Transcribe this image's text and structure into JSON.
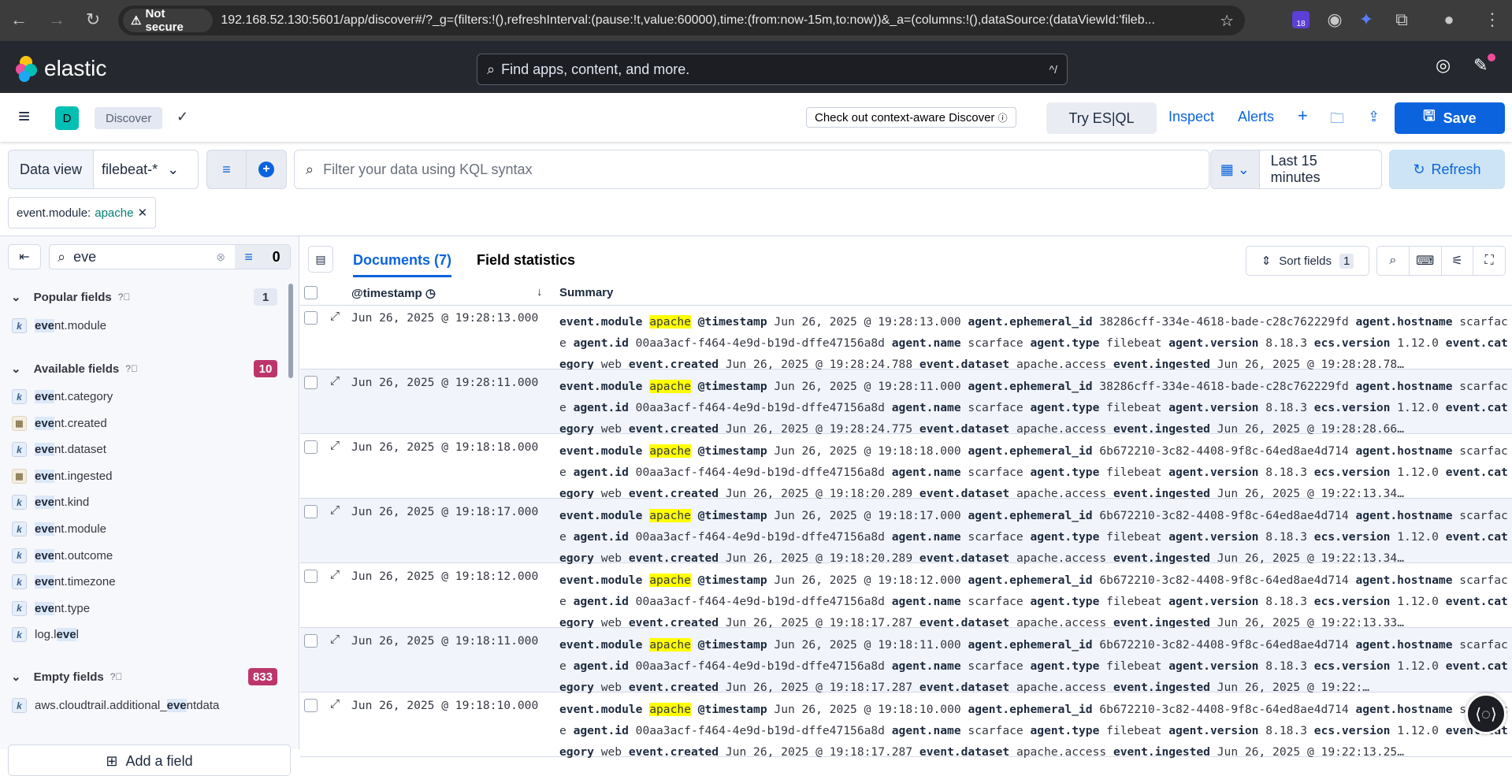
{
  "browser": {
    "not_secure": "Not secure",
    "url": "192.168.52.130:5601/app/discover#/?_g=(filters:!(),refreshInterval:(pause:!t,value:60000),time:(from:now-15m,to:now))&_a=(columns:!(),dataSource:(dataViewId:'fileb...",
    "ext_badge": "18"
  },
  "header": {
    "logo": "elastic",
    "search_placeholder": "Find apps, content, and more.",
    "shortcut": "^/"
  },
  "appbar": {
    "space": "D",
    "breadcrumb": "Discover",
    "context_button": "Check out context-aware Discover",
    "esql": "Try ES|QL",
    "inspect": "Inspect",
    "alerts": "Alerts",
    "save": "Save"
  },
  "query": {
    "data_view_label": "Data view",
    "data_view": "filebeat-*",
    "placeholder": "Filter your data using KQL syntax",
    "time": "Last 15 minutes",
    "refresh": "Refresh"
  },
  "filter_pill": {
    "key": "event.module:",
    "value": "apache"
  },
  "sidebar": {
    "search_value": "eve",
    "filter_count": "0",
    "add_field": "Add a field",
    "popular": {
      "title": "Popular fields",
      "count": "1"
    },
    "available": {
      "title": "Available fields",
      "count": "10",
      "color": "#bd366b"
    },
    "empty": {
      "title": "Empty fields",
      "count": "833",
      "color": "#bd366b"
    },
    "popular_fields": [
      {
        "name": "event.module",
        "type": "keyword"
      }
    ],
    "available_fields": [
      {
        "name": "event.category",
        "type": "keyword"
      },
      {
        "name": "event.created",
        "type": "date"
      },
      {
        "name": "event.dataset",
        "type": "keyword"
      },
      {
        "name": "event.ingested",
        "type": "date"
      },
      {
        "name": "event.kind",
        "type": "keyword"
      },
      {
        "name": "event.module",
        "type": "keyword"
      },
      {
        "name": "event.outcome",
        "type": "keyword"
      },
      {
        "name": "event.timezone",
        "type": "keyword"
      },
      {
        "name": "event.type",
        "type": "keyword"
      },
      {
        "name": "log.level",
        "type": "keyword"
      }
    ],
    "empty_fields": [
      {
        "name": "aws.cloudtrail.additional_eventdata",
        "type": "keyword"
      }
    ]
  },
  "main": {
    "tab_documents": "Documents (7)",
    "tab_stats": "Field statistics",
    "sort_fields": "Sort fields",
    "sort_count": "1",
    "col_timestamp": "@timestamp",
    "col_summary": "Summary"
  },
  "rows": [
    {
      "ts": "Jun 26, 2025 @ 19:28:13.000",
      "eph": "38286cff-334e-4618-bade-c28c762229fd",
      "created": "Jun 26, 2025 @ 19:28:24.788",
      "ingested": "Jun 26, 2025 @ 19:28:28.78"
    },
    {
      "ts": "Jun 26, 2025 @ 19:28:11.000",
      "eph": "38286cff-334e-4618-bade-c28c762229fd",
      "created": "Jun 26, 2025 @ 19:28:24.775",
      "ingested": "Jun 26, 2025 @ 19:28:28.66"
    },
    {
      "ts": "Jun 26, 2025 @ 19:18:18.000",
      "eph": "6b672210-3c82-4408-9f8c-64ed8ae4d714",
      "created": "Jun 26, 2025 @ 19:18:20.289",
      "ingested": "Jun 26, 2025 @ 19:22:13.34"
    },
    {
      "ts": "Jun 26, 2025 @ 19:18:17.000",
      "eph": "6b672210-3c82-4408-9f8c-64ed8ae4d714",
      "created": "Jun 26, 2025 @ 19:18:20.289",
      "ingested": "Jun 26, 2025 @ 19:22:13.34"
    },
    {
      "ts": "Jun 26, 2025 @ 19:18:12.000",
      "eph": "6b672210-3c82-4408-9f8c-64ed8ae4d714",
      "created": "Jun 26, 2025 @ 19:18:17.287",
      "ingested": "Jun 26, 2025 @ 19:22:13.33"
    },
    {
      "ts": "Jun 26, 2025 @ 19:18:11.000",
      "eph": "6b672210-3c82-4408-9f8c-64ed8ae4d714",
      "created": "Jun 26, 2025 @ 19:18:17.287",
      "ingested": "Jun 26, 2025 @ 19:22:"
    },
    {
      "ts": "Jun 26, 2025 @ 19:18:10.000",
      "eph": "6b672210-3c82-4408-9f8c-64ed8ae4d714",
      "created": "Jun 26, 2025 @ 19:18:17.287",
      "ingested": "Jun 26, 2025 @ 19:22:13.25"
    }
  ],
  "row_common": {
    "module": "apache",
    "hostname": "scarface",
    "agent_id": "00aa3acf-f464-4e9d-b19d-dffe47156a8d",
    "agent_name": "scarface",
    "agent_type": "filebeat",
    "agent_version": "8.18.3",
    "ecs_version": "1.12.0",
    "category": "web",
    "dataset": "apache.access"
  }
}
